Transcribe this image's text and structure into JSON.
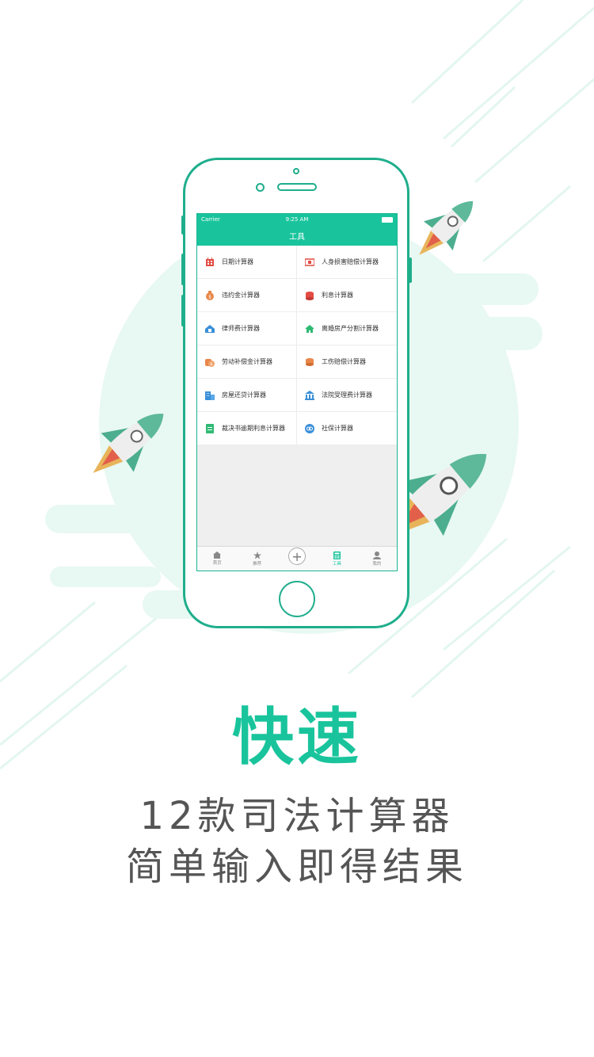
{
  "colors": {
    "accent": "#19c49c",
    "phone_frame": "#1fae8c",
    "mint_bg": "#e6f7f1",
    "stripe": "#dff5ee",
    "text": "#555555"
  },
  "status_bar": {
    "carrier": "Carrier",
    "time": "9:25 AM"
  },
  "nav": {
    "title": "工具"
  },
  "tools": [
    {
      "label": "日期计算器",
      "icon": "calendar-icon"
    },
    {
      "label": "人身损害赔偿计算器",
      "icon": "injury-icon"
    },
    {
      "label": "违约金计算器",
      "icon": "money-bag-icon"
    },
    {
      "label": "利息计算器",
      "icon": "coin-stack-icon"
    },
    {
      "label": "律师费计算器",
      "icon": "lawyer-icon"
    },
    {
      "label": "离婚房产分割计算器",
      "icon": "house-icon"
    },
    {
      "label": "劳动补偿金计算器",
      "icon": "labor-coin-icon"
    },
    {
      "label": "工伤赔偿计算器",
      "icon": "work-injury-icon"
    },
    {
      "label": "房屋还贷计算器",
      "icon": "building-icon"
    },
    {
      "label": "法院受理费计算器",
      "icon": "court-icon"
    },
    {
      "label": "裁决书逾期利息计算器",
      "icon": "document-icon"
    },
    {
      "label": "社保计算器",
      "icon": "social-security-icon"
    }
  ],
  "tab_bar": {
    "home": "首页",
    "recommend": "推荐",
    "add": "+",
    "tools": "工具",
    "mine": "我的"
  },
  "promo": {
    "headline": "快速",
    "line1": "12款司法计算器",
    "line2": "简单输入即得结果"
  }
}
